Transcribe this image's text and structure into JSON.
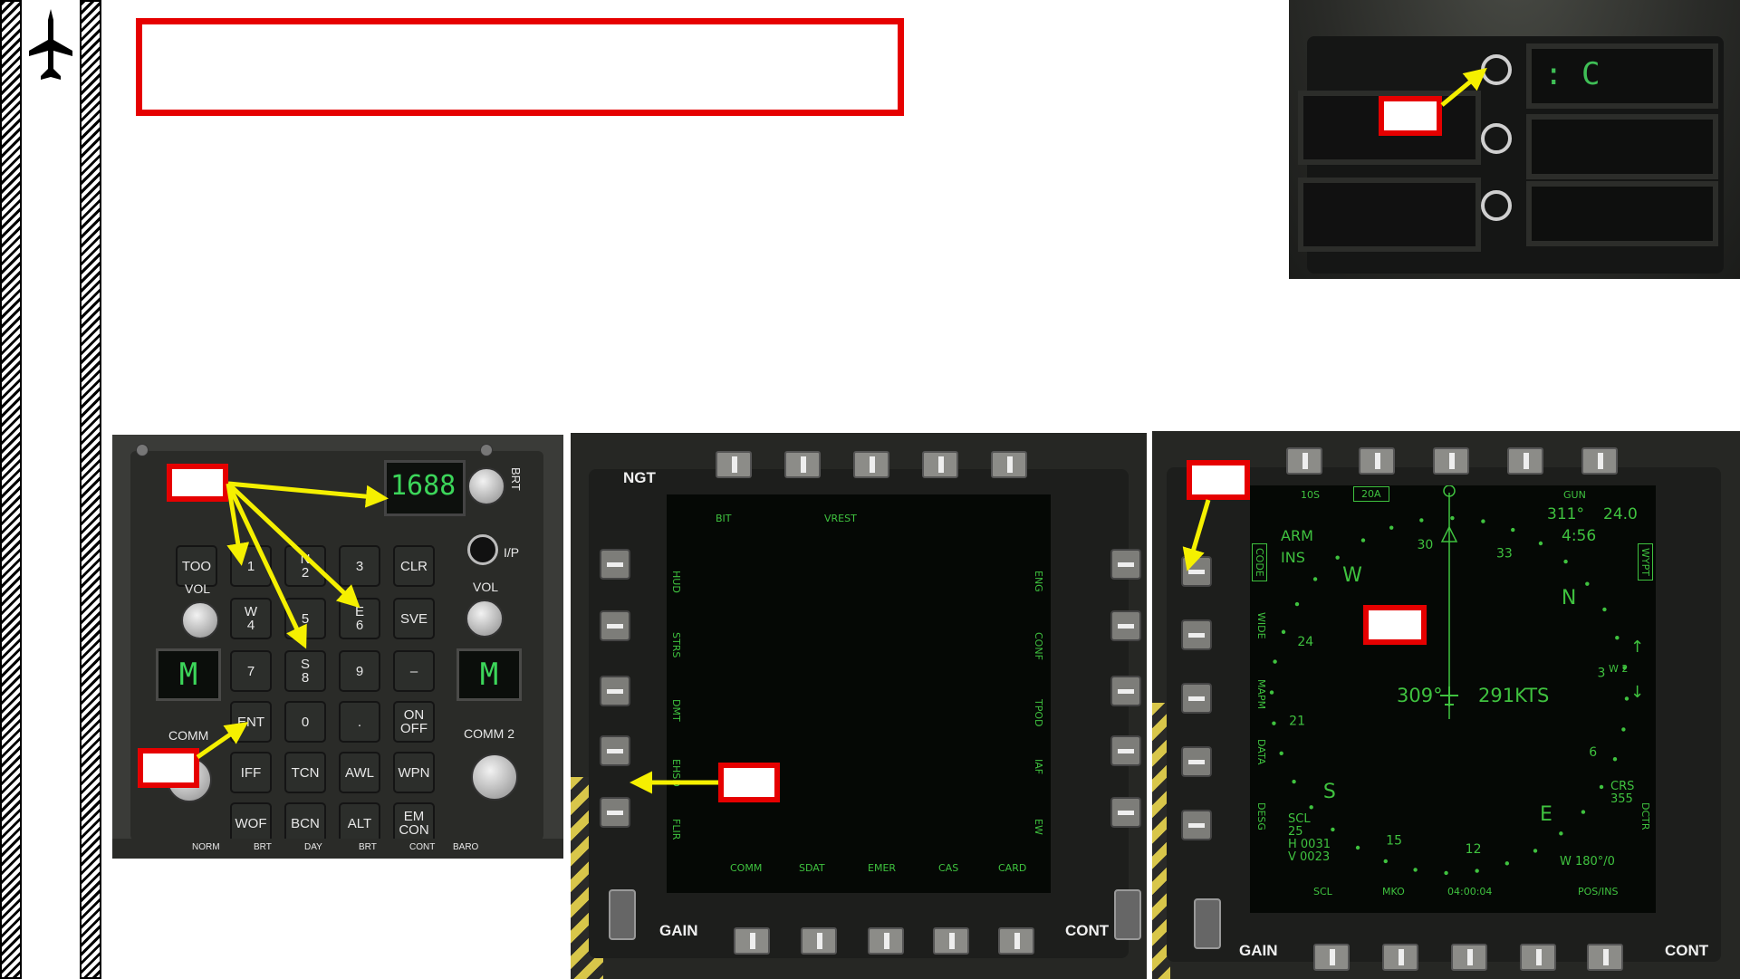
{
  "header": {
    "logo_icon": "jet-aircraft-icon"
  },
  "ufc_panel": {
    "option_display": "1688",
    "brt_label": "BRT",
    "keys": [
      {
        "label": "TOO"
      },
      {
        "label": "1"
      },
      {
        "label": "N\n2"
      },
      {
        "label": "3"
      },
      {
        "label": "CLR"
      },
      {
        "label": "W\n4"
      },
      {
        "label": "5"
      },
      {
        "label": "E\n6"
      },
      {
        "label": "SVE"
      },
      {
        "label": "7"
      },
      {
        "label": "S\n8"
      },
      {
        "label": "9"
      },
      {
        "label": "–"
      },
      {
        "label": "ENT"
      },
      {
        "label": "0"
      },
      {
        "label": "."
      },
      {
        "label": "ON\nOFF"
      },
      {
        "label": "IFF"
      },
      {
        "label": "TCN"
      },
      {
        "label": "AWL"
      },
      {
        "label": "WPN"
      },
      {
        "label": "WOF"
      },
      {
        "label": "BCN"
      },
      {
        "label": "ALT"
      },
      {
        "label": "EM\nCON"
      }
    ],
    "ip_label": "I/P",
    "vol_left": "VOL",
    "vol_right": "VOL",
    "comm1_label": "COMM",
    "comm2_label": "COMM 2",
    "comm1_display": "M",
    "comm2_display": "M",
    "bottom_labels": [
      "NORM",
      "BRT",
      "DAY",
      "BRT",
      "CONT",
      "BARO"
    ]
  },
  "mfd_left": {
    "mode": "NGT",
    "top_labels": [
      "BIT",
      "VREST"
    ],
    "left_labels": [
      "HUD",
      "STRS",
      "DMT",
      "EHSD",
      "FLIR"
    ],
    "right_labels": [
      "ENG",
      "CONF",
      "TPOD",
      "IAF",
      "EW"
    ],
    "bottom_labels": [
      "COMM",
      "SDAT",
      "EMER",
      "CAS",
      "CARD"
    ],
    "gain_label": "GAIN",
    "cont_label": "CONT"
  },
  "mfd_right": {
    "top_options": [
      "10S",
      "20A"
    ],
    "gun_label": "GUN",
    "heading_deg": "311°",
    "dist": "24.0",
    "time": "4:56",
    "arm_label": "ARM",
    "ins_label": "INS",
    "code_label": "CODE",
    "wide_label": "WIDE",
    "mapm_label": "MAPM",
    "data_label": "DATA",
    "desg_label": "DESG",
    "wypt_label": "WYPT",
    "dctr_label": "DCTR",
    "compass": [
      "N",
      "E",
      "S",
      "W",
      "3",
      "6",
      "12",
      "15",
      "21",
      "24",
      "30",
      "33"
    ],
    "track": "309°",
    "speed": "291KTS",
    "wpt_num": "W 2",
    "crs": "CRS\n355",
    "scl_block": "SCL\n25\nH 0031\nV 0023",
    "wind": "W 180°/0",
    "bottom_labels": [
      "SCL",
      "MKO",
      "04:00:04",
      "POS/INS"
    ],
    "gain_label": "GAIN",
    "cont_label": "CONT"
  },
  "cockpit_top": {
    "display_text": ": C"
  },
  "colors": {
    "callout": "#e60000",
    "arrow": "#f5f000",
    "display_green": "#3fc23f"
  }
}
